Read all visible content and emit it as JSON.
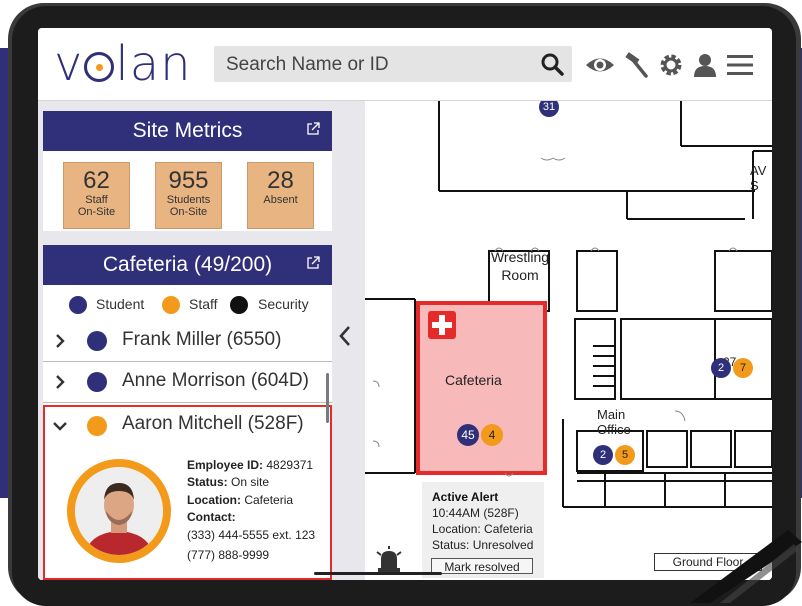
{
  "app": {
    "logo": "volan"
  },
  "header": {
    "search_placeholder": "Search Name or ID",
    "icons": [
      "search-icon",
      "eye-icon",
      "hammer-icon",
      "gear-icon",
      "user-icon",
      "menu-icon"
    ]
  },
  "metrics": {
    "title": "Site Metrics",
    "items": [
      {
        "value": "62",
        "label1": "Staff",
        "label2": "On-Site"
      },
      {
        "value": "955",
        "label1": "Students",
        "label2": "On-Site"
      },
      {
        "value": "28",
        "label1": "Absent",
        "label2": ""
      }
    ]
  },
  "location": {
    "title": "Cafeteria (49/200)",
    "legend": [
      {
        "label": "Student",
        "color": "#2f3079"
      },
      {
        "label": "Staff",
        "color": "#f39a1b"
      },
      {
        "label": "Security",
        "color": "#111111"
      }
    ],
    "people": [
      {
        "name": "Frank Miller (6550)",
        "color": "#2f3079"
      },
      {
        "name": "Anne Morrison (604D)",
        "color": "#2f3079"
      },
      {
        "name": "Aaron Mitchell (528F)",
        "color": "#f39a1b"
      }
    ],
    "detail": {
      "employee_id_label": "Employee ID:",
      "employee_id": "4829371",
      "status_label": "Status:",
      "status": "On site",
      "location_label": "Location:",
      "location": "Cafeteria",
      "contact_label": "Contact:",
      "phone1": "(333) 444-5555 ext. 123",
      "phone2": "(777) 888-9999"
    }
  },
  "map": {
    "rooms": {
      "wrestling1": "Wrestling",
      "wrestling2": "Room",
      "cafeteria": "Cafeteria",
      "main1": "Main",
      "main2": "Office",
      "av": "AV S",
      "room27": "27"
    },
    "badges": [
      {
        "value": "31",
        "color": "#2f3079"
      },
      {
        "value": "45",
        "color": "#2f3079"
      },
      {
        "value": "4",
        "color": "#f39a1b"
      },
      {
        "value": "2",
        "color": "#2f3079"
      },
      {
        "value": "7",
        "color": "#f39a1b"
      },
      {
        "value": "2",
        "color": "#2f3079"
      },
      {
        "value": "5",
        "color": "#f39a1b"
      }
    ],
    "alert": {
      "title": "Active Alert",
      "time": "10:44AM (528F)",
      "location": "Location: Cafeteria",
      "status": "Status: Unresolved",
      "button": "Mark resolved"
    },
    "floor": "Ground Floor"
  },
  "colors": {
    "brand": "#2f3079",
    "staff": "#f39a1b",
    "alert": "#e52a2a",
    "metric_tile": "#e8b482"
  }
}
